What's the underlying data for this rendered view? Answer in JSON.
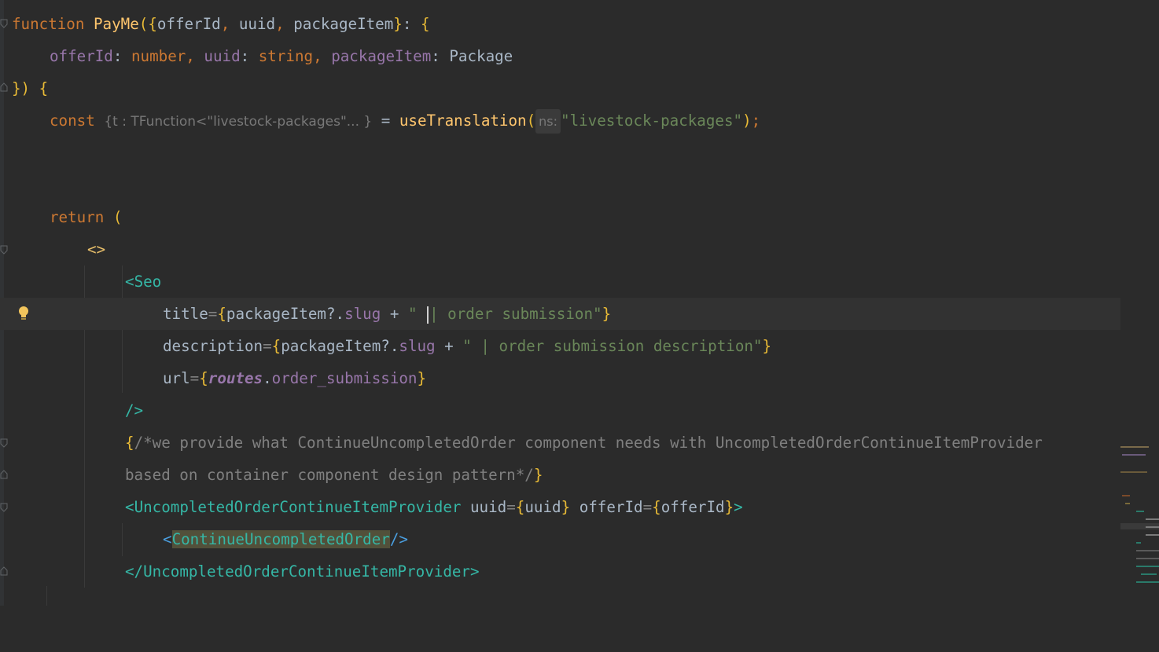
{
  "editor": {
    "lines": [
      {
        "text": "function PayMe({offerId, uuid, packageItem}: {"
      },
      {
        "text": "offerId: number, uuid: string, packageItem: Package"
      },
      {
        "text": "}) {"
      },
      {
        "text": "const {t: TFunction<\"livestock-packages\"...} = useTranslation(ns: \"livestock-packages\");"
      },
      {
        "text": "return ("
      },
      {
        "text": "<>"
      },
      {
        "text": "<Seo"
      },
      {
        "text": "title={packageItem?.slug + \" | order submission\"}"
      },
      {
        "text": "description={packageItem?.slug + \" | order submission description\"}"
      },
      {
        "text": "url={routes.order_submission}"
      },
      {
        "text": "/>"
      },
      {
        "text": "{/*we provide what ContinueUncompletedOrder component needs with UncompletedOrderContinueItemProvider"
      },
      {
        "text": "based on container component design pattern*/}"
      },
      {
        "text": "<UncompletedOrderContinueItemProvider uuid={uuid} offerId={offerId}>"
      },
      {
        "text": "<ContinueUncompletedOrder/>"
      },
      {
        "text": "</UncompletedOrderContinueItemProvider>"
      }
    ],
    "tokens": {
      "function": "function",
      "PayMe": "PayMe",
      "offerId": "offerId",
      "uuid": "uuid",
      "packageItem": "packageItem",
      "number": "number",
      "string": "string",
      "Package": "Package",
      "const": "const",
      "hint_t": "{t : TFunction<\"livestock-packages\"... }",
      "useTranslation": "useTranslation",
      "hint_ns": "ns:",
      "ns_value": "\"livestock-packages\"",
      "return": "return",
      "fragment": "<>",
      "Seo": "Seo",
      "title": "title",
      "slug": "slug",
      "title_str_a": "\" ",
      "title_str_b": "| order submission\"",
      "description": "description",
      "desc_str": "\" | order submission description\"",
      "url": "url",
      "routes": "routes",
      "order_submission": "order_submission",
      "comment_1": "/*we provide what ContinueUncompletedOrder component needs with UncompletedOrderContinueItemProvider",
      "comment_2": "based on container component design pattern*/",
      "provider": "UncompletedOrderContinueItemProvider",
      "continue": "ContinueUncompletedOrder"
    },
    "colors": {
      "background": "#2b2b2b",
      "current_line": "#323232",
      "keyword": "#cc7832",
      "function": "#ffc66d",
      "property": "#9876aa",
      "string": "#6a8759",
      "tag_name": "#35b7a6",
      "comment": "#808080",
      "text": "#a9b7c6"
    }
  }
}
